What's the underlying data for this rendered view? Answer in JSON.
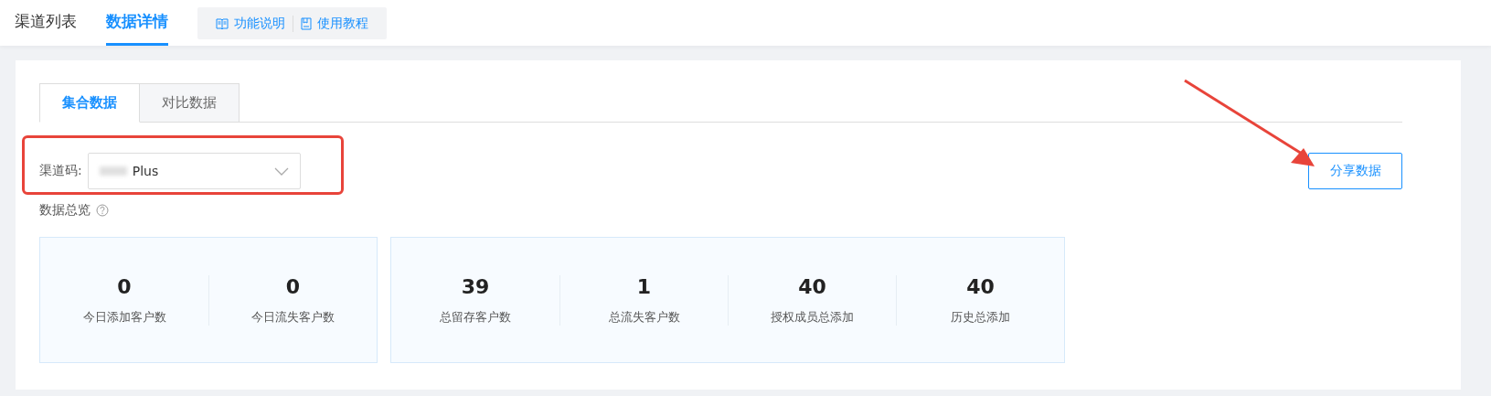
{
  "top_tabs": [
    {
      "label": "渠道列表",
      "selected": false
    },
    {
      "label": "数据详情",
      "selected": true
    }
  ],
  "help_links": [
    {
      "kind": "book",
      "label": "功能说明"
    },
    {
      "kind": "doc",
      "label": "使用教程"
    }
  ],
  "data_tabs": [
    {
      "label": "集合数据",
      "selected": true
    },
    {
      "label": "对比数据",
      "selected": false
    }
  ],
  "channel_field": {
    "label": "渠道码:",
    "value": "Plus"
  },
  "share_button": "分享数据",
  "overview_title": "数据总览",
  "stat_groups": [
    [
      {
        "value": "0",
        "label": "今日添加客户数"
      },
      {
        "value": "0",
        "label": "今日流失客户数"
      }
    ],
    [
      {
        "value": "39",
        "label": "总留存客户数"
      },
      {
        "value": "1",
        "label": "总流失客户数"
      },
      {
        "value": "40",
        "label": "授权成员总添加"
      },
      {
        "value": "40",
        "label": "历史总添加"
      }
    ]
  ]
}
